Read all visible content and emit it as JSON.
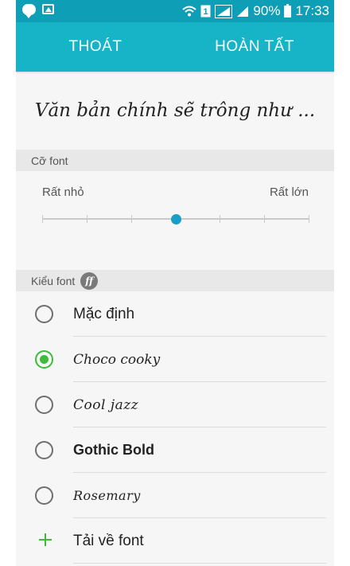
{
  "status_bar": {
    "battery": "90%",
    "time": "17:33",
    "icons": [
      "chat-icon",
      "image-icon",
      "wifi-icon",
      "sim-1-icon",
      "signal-icon",
      "signal-icon",
      "battery-icon"
    ]
  },
  "top_bar": {
    "exit_label": "THOÁT",
    "done_label": "HOÀN TẤT"
  },
  "preview": {
    "text": "Văn bản chính sẽ trông như ..."
  },
  "font_size": {
    "header": "Cỡ font",
    "min_label": "Rất nhỏ",
    "max_label": "Rất lớn",
    "steps": 7,
    "selected_step": 4
  },
  "font_style": {
    "header": "Kiểu font",
    "badge": "ff",
    "options": [
      {
        "label": "Mặc định",
        "selected": false
      },
      {
        "label": "Choco cooky",
        "selected": true
      },
      {
        "label": "Cool jazz",
        "selected": false
      },
      {
        "label": "Gothic Bold",
        "selected": false
      },
      {
        "label": "Rosemary",
        "selected": false
      }
    ],
    "download_label": "Tải về font"
  },
  "colors": {
    "accent": "#17b4c8",
    "status_bar": "#0e9fb6",
    "selected_radio": "#3fbb3c",
    "slider_thumb": "#1aa0c6"
  }
}
